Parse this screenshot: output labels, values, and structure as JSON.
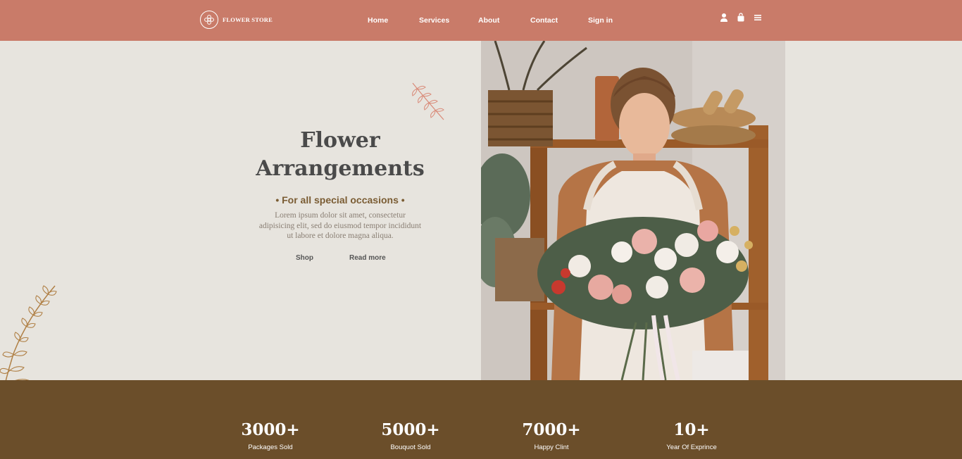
{
  "header": {
    "brand": "FLOWER STORE",
    "nav": [
      "Home",
      "Services",
      "About",
      "Contact",
      "Sign in"
    ],
    "icons": [
      "user-icon",
      "shopping-bag-icon",
      "menu-icon"
    ]
  },
  "hero": {
    "title_line1": "Flower",
    "title_line2": "Arrangements",
    "subtitle": "• For all special occasions •",
    "description": "Lorem ipsum dolor sit amet, consectetur adipisicing elit, sed do eiusmod tempor incididunt ut labore et dolore magna aliqua.",
    "buttons": [
      "Shop",
      "Read more"
    ]
  },
  "stats": [
    {
      "value": "3000+",
      "label": "Packages Sold"
    },
    {
      "value": "5000+",
      "label": "Bouquot Sold"
    },
    {
      "value": "7000+",
      "label": "Happy Clint"
    },
    {
      "value": "10+",
      "label": "Year Of Exprince"
    }
  ],
  "colors": {
    "header": "#c97b69",
    "background": "#e7e4de",
    "stats_band": "#6b4e2a",
    "subtitle": "#7a5c33"
  }
}
